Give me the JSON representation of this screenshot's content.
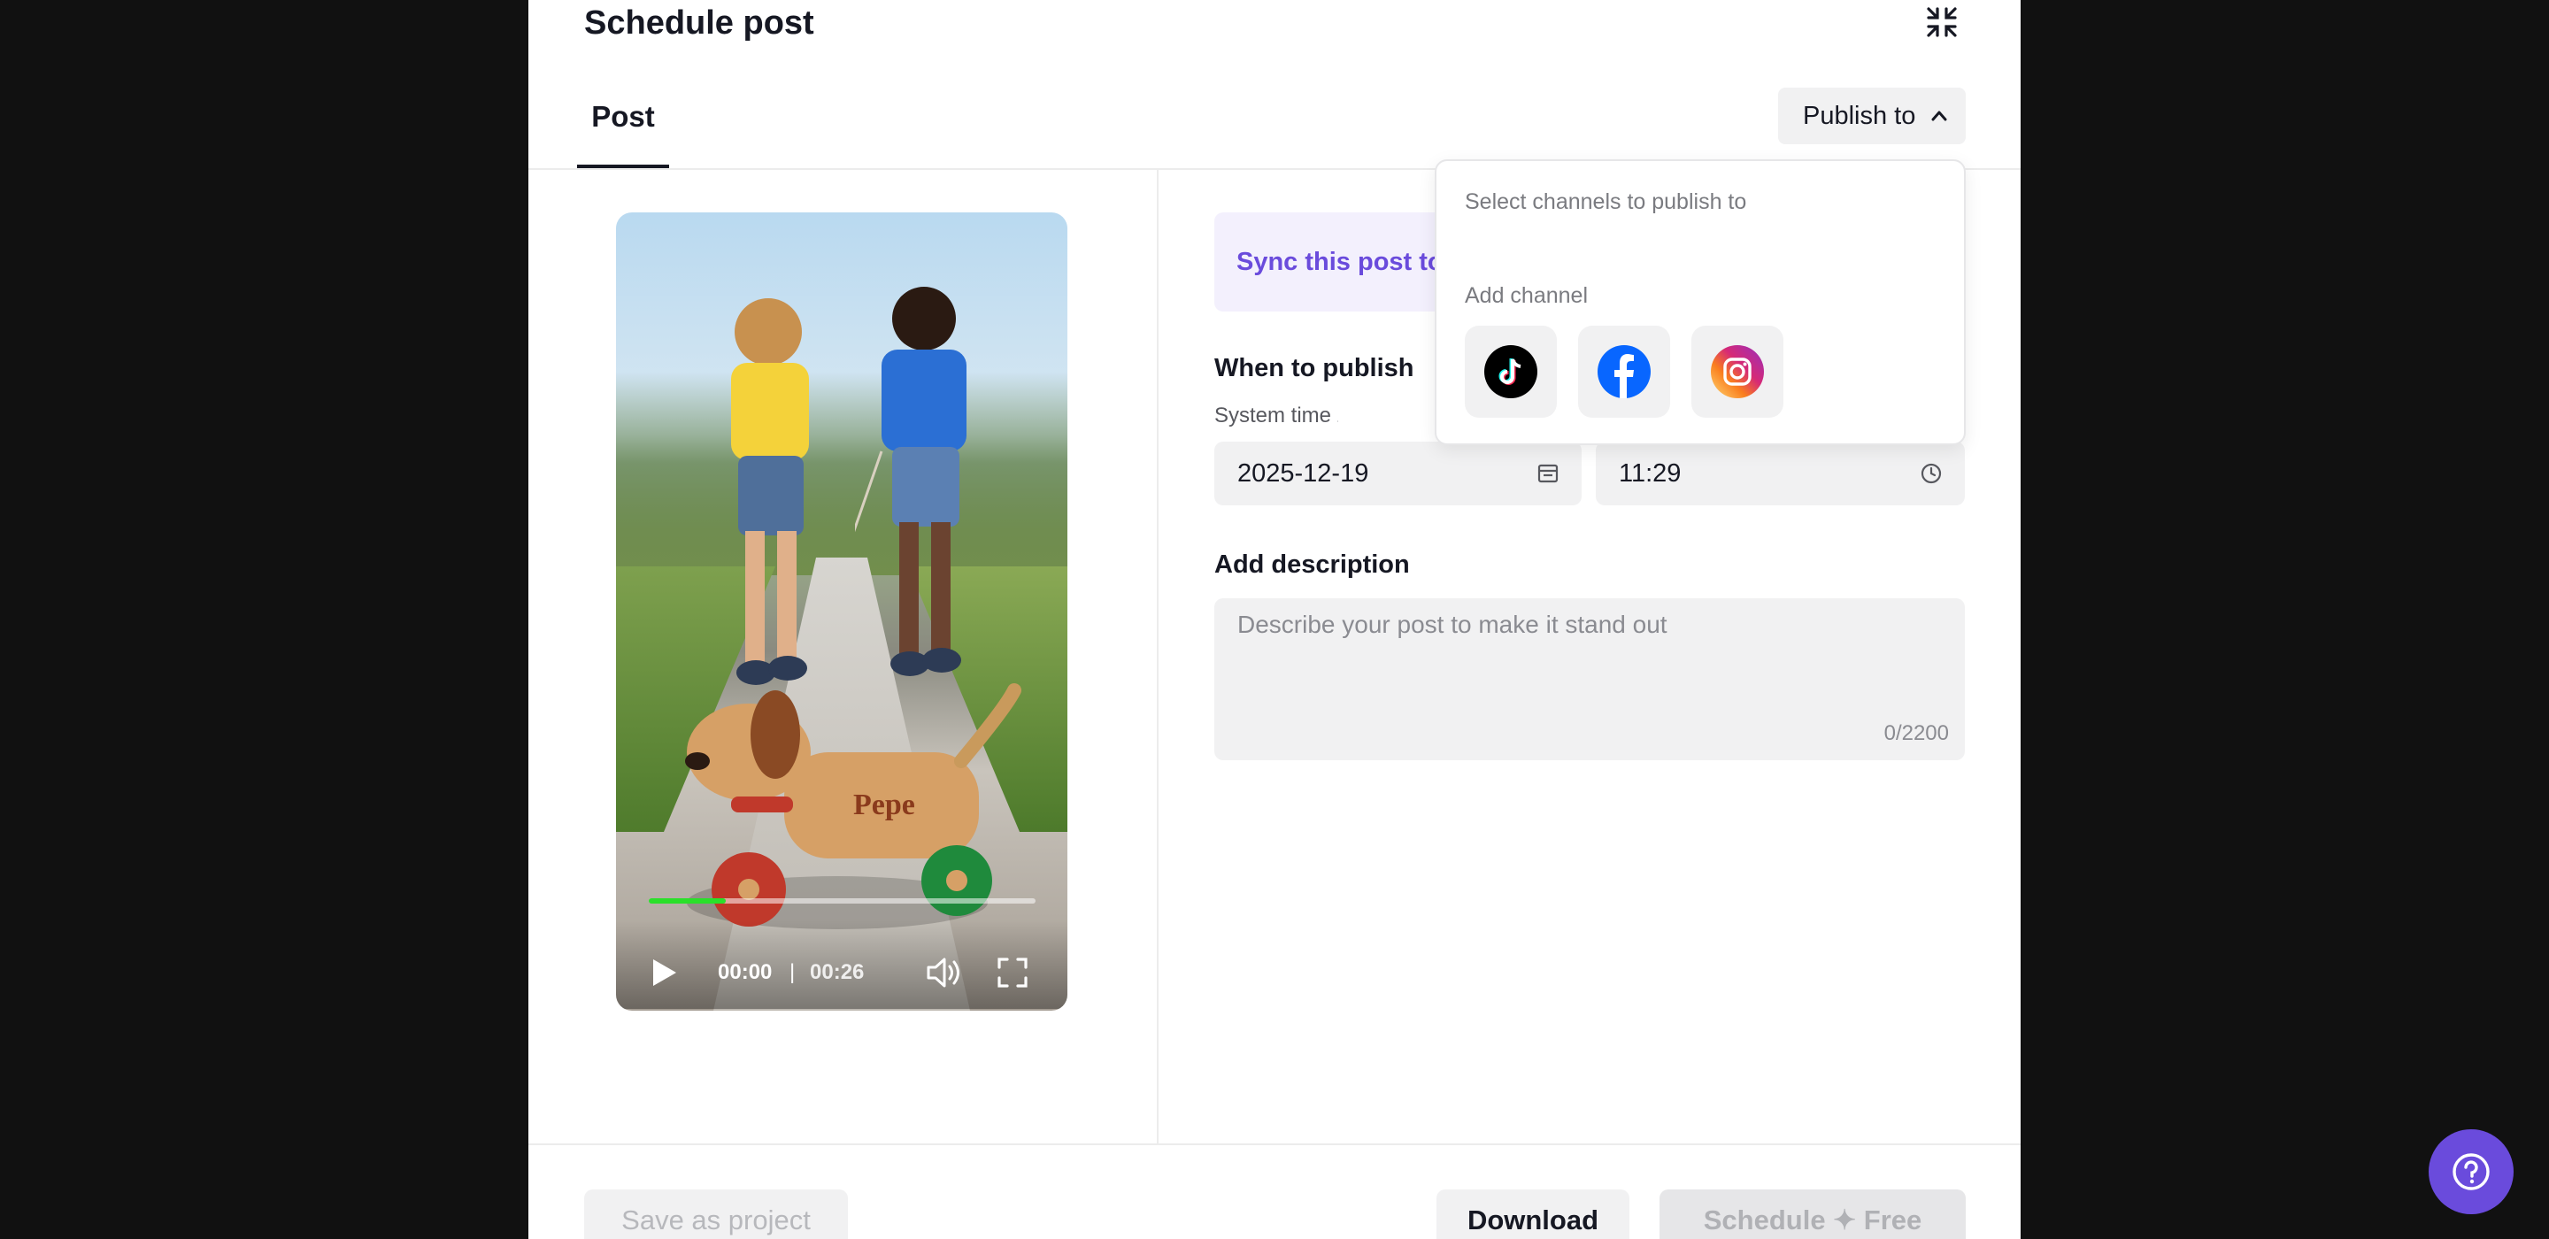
{
  "modal": {
    "title": "Schedule post",
    "tab_post": "Post",
    "publish_to_label": "Publish to"
  },
  "video": {
    "current_time": "00:00",
    "separator": "|",
    "duration": "00:26",
    "progress_fraction": 0.2,
    "toy_name": "Pepe"
  },
  "form": {
    "sync_text": "Sync this post to",
    "when_label": "When to publish",
    "timezone_text": "System time zone: Asia",
    "date_value": "2025-12-19",
    "time_value": "11:29",
    "description_label": "Add description",
    "description_placeholder": "Describe your post to make it stand out",
    "description_count": "0/2200"
  },
  "dropdown": {
    "title": "Select channels to publish to",
    "add_channel_label": "Add channel",
    "channels": [
      "tiktok-icon",
      "facebook-icon",
      "instagram-icon"
    ]
  },
  "footer": {
    "save_label": "Save as project",
    "download_label": "Download",
    "schedule_label": "Schedule ✦ Free"
  },
  "colors": {
    "accent": "#6a4bdc",
    "progress": "#2ae02a",
    "facebook": "#0866ff"
  }
}
